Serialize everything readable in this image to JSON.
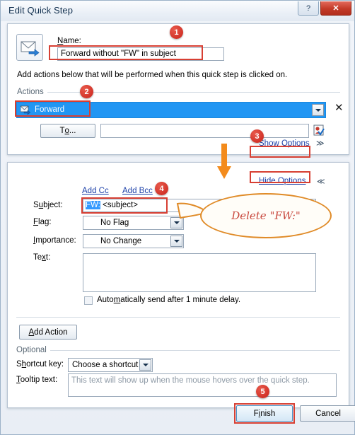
{
  "window": {
    "title": "Edit Quick Step",
    "help_button": "?",
    "close_button": "✕"
  },
  "top_panel": {
    "icon": "forward-envelope-icon",
    "name_label": "Name:",
    "name_value": "Forward without \"FW\" in subject",
    "description": "Add actions below that will be performed when this quick step is clicked on.",
    "actions_group_label": "Actions",
    "action": {
      "label": "Forward",
      "icon": "forward-mail-icon",
      "dropdown_arrow": "▼",
      "remove_button": "✕"
    },
    "to_button": "To...",
    "to_value": "",
    "address_book_icon": "address-book-icon",
    "show_options_link": "Show Options",
    "expand_chevron": "≫"
  },
  "bottom_panel": {
    "hide_options_link": "Hide Options",
    "collapse_chevron": "≪",
    "add_cc_link": "Add Cc",
    "add_bcc_link": "Add Bcc",
    "subject_label": "Subject:",
    "subject_selected_text": "FW:",
    "subject_rest_text": " <subject>",
    "flag_label": "Flag:",
    "flag_value": "No Flag",
    "importance_label": "Importance:",
    "importance_value": "No Change",
    "text_label": "Text:",
    "text_value": "",
    "auto_send_label": "Automatically send after 1 minute delay.",
    "auto_send_checked": false,
    "add_action_button": "Add Action",
    "optional_group_label": "Optional",
    "shortcut_label": "Shortcut key:",
    "shortcut_value": "Choose a shortcut",
    "tooltip_label": "Tooltip text:",
    "tooltip_placeholder": "This text will show up when the mouse hovers over the quick step."
  },
  "footer": {
    "finish_button": "Finish",
    "cancel_button": "Cancel"
  },
  "annotations": {
    "badges": [
      "1",
      "2",
      "3",
      "4",
      "5"
    ],
    "callout_text": "Delete \"FW:\"",
    "highlight_color": "#d73f33",
    "arrow_color": "#f38b1c",
    "callout_border_color": "#e08b28",
    "callout_text_color": "#c9493f"
  }
}
